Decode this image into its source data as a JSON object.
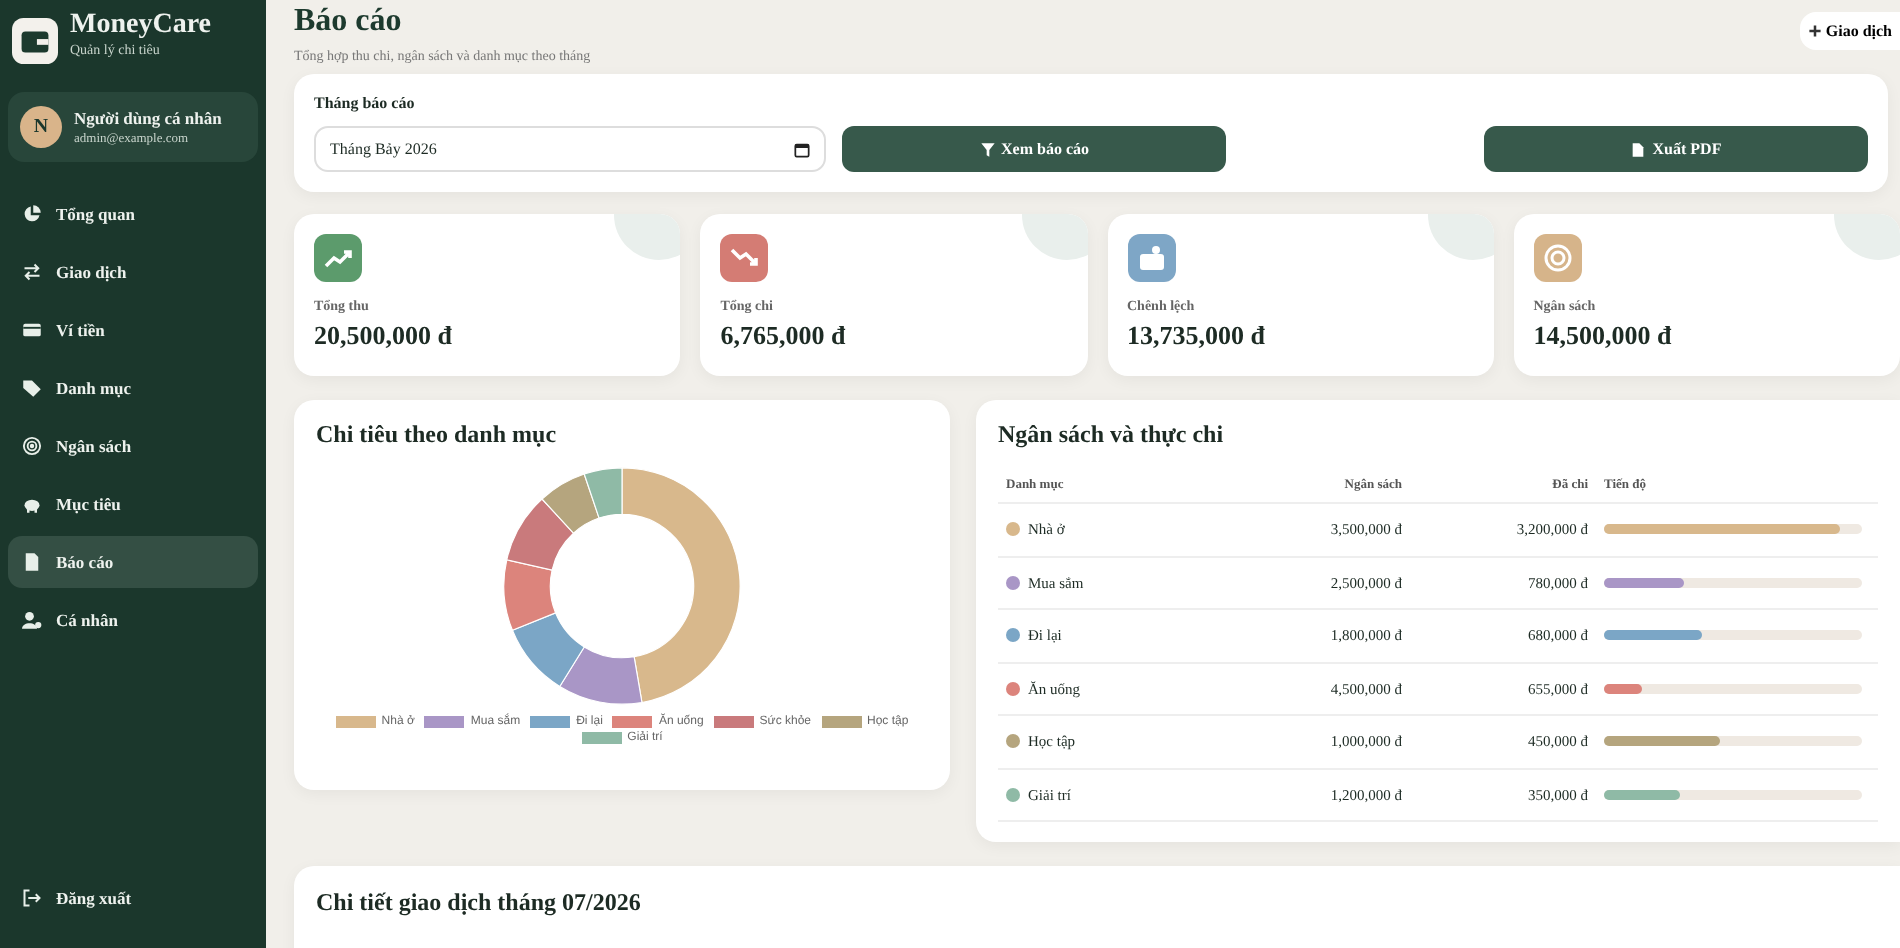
{
  "brand": {
    "name": "MoneyCare",
    "tagline": "Quản lý chi tiêu"
  },
  "user": {
    "initial": "N",
    "name": "Người dùng cá nhân",
    "email": "admin@example.com"
  },
  "nav": [
    {
      "label": "Tổng quan",
      "selected": false
    },
    {
      "label": "Giao dịch",
      "selected": false
    },
    {
      "label": "Ví tiền",
      "selected": false
    },
    {
      "label": "Danh mục",
      "selected": false
    },
    {
      "label": "Ngân sách",
      "selected": false
    },
    {
      "label": "Mục tiêu",
      "selected": false
    },
    {
      "label": "Báo cáo",
      "selected": true
    },
    {
      "label": "Cá nhân",
      "selected": false
    }
  ],
  "logout": "Đăng xuất",
  "header": {
    "title": "Báo cáo",
    "subtitle": "Tổng hợp thu chi, ngân sách và danh mục theo tháng",
    "add_button": "Giao dịch"
  },
  "filter": {
    "label": "Tháng báo cáo",
    "month_value": "Tháng Bảy 2026",
    "view_button": "Xem báo cáo",
    "pdf_button": "Xuất PDF"
  },
  "stats": [
    {
      "label": "Tổng thu",
      "value": "20,500,000 đ",
      "color": "#5c9b6c"
    },
    {
      "label": "Tổng chi",
      "value": "6,765,000 đ",
      "color": "#d47c74"
    },
    {
      "label": "Chênh lệch",
      "value": "13,735,000 đ",
      "color": "#7ea6c6"
    },
    {
      "label": "Ngân sách",
      "value": "14,500,000 đ",
      "color": "#d6b48a"
    }
  ],
  "category_chart": {
    "title": "Chi tiêu theo danh mục",
    "slices": [
      {
        "color": "#d8b88c"
      },
      {
        "color": "#a996c6"
      },
      {
        "color": "#7ba6c6"
      },
      {
        "color": "#dc847c"
      },
      {
        "color": "#c97a7c"
      },
      {
        "color": "#b5a57e"
      },
      {
        "color": "#8fbaa6"
      }
    ],
    "chart_data": {
      "type": "donut",
      "categories": [
        "Nhà ở",
        "Mua sắm",
        "Đi lại",
        "Ăn uống",
        "Sức khỏe",
        "Học tập",
        "Giải trí"
      ],
      "values": [
        47.3,
        11.53,
        10.05,
        9.68,
        9.61,
        6.65,
        5.18
      ]
    }
  },
  "budget": {
    "title": "Ngân sách và thực chi",
    "columns": [
      "Danh mục",
      "Ngân sách",
      "Đã chi",
      "Tiến độ"
    ],
    "rows": [
      {
        "name": "Nhà ở",
        "budget": "3,500,000 đ",
        "spent": "3,200,000 đ",
        "level": 0.914,
        "color": "#d8b88c"
      },
      {
        "name": "Mua sắm",
        "budget": "2,500,000 đ",
        "spent": "780,000 đ",
        "level": 0.312,
        "color": "#a996c6"
      },
      {
        "name": "Đi lại",
        "budget": "1,800,000 đ",
        "spent": "680,000 đ",
        "level": 0.378,
        "color": "#7ba6c6"
      },
      {
        "name": "Ăn uống",
        "budget": "4,500,000 đ",
        "spent": "655,000 đ",
        "level": 0.146,
        "color": "#dc847c"
      },
      {
        "name": "Học tập",
        "budget": "1,000,000 đ",
        "spent": "450,000 đ",
        "level": 0.45,
        "color": "#b5a57e"
      },
      {
        "name": "Giải trí",
        "budget": "1,200,000 đ",
        "spent": "350,000 đ",
        "level": 0.292,
        "color": "#8fbaa6"
      }
    ]
  },
  "details": {
    "title": "Chi tiết giao dịch tháng 07/2026"
  }
}
